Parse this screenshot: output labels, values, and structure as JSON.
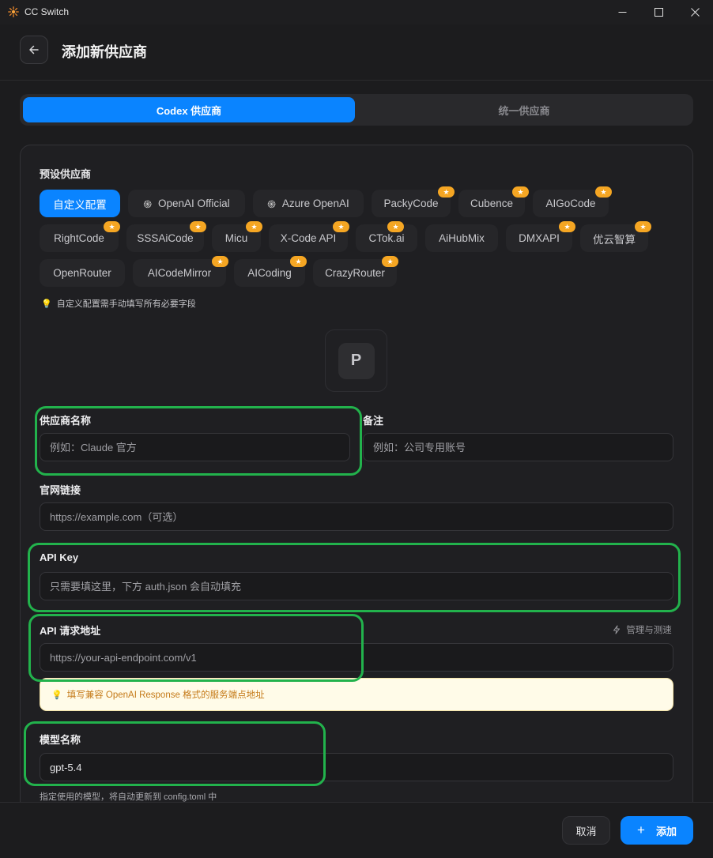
{
  "window": {
    "title": "CC Switch",
    "minimize": "—",
    "maximize": "☐",
    "close": "✕"
  },
  "header": {
    "title": "添加新供应商"
  },
  "tabs": [
    {
      "label": "Codex 供应商",
      "active": true
    },
    {
      "label": "统一供应商",
      "active": false
    }
  ],
  "presets": {
    "label": "预设供应商",
    "items": [
      {
        "label": "自定义配置",
        "active": true,
        "starred": false,
        "icon": ""
      },
      {
        "label": "OpenAI Official",
        "active": false,
        "starred": false,
        "icon": "openai-icon"
      },
      {
        "label": "Azure OpenAI",
        "active": false,
        "starred": false,
        "icon": "openai-icon"
      },
      {
        "label": "PackyCode",
        "active": false,
        "starred": true,
        "icon": ""
      },
      {
        "label": "Cubence",
        "active": false,
        "starred": true,
        "icon": ""
      },
      {
        "label": "AIGoCode",
        "active": false,
        "starred": true,
        "icon": ""
      },
      {
        "label": "RightCode",
        "active": false,
        "starred": true,
        "icon": ""
      },
      {
        "label": "SSSAiCode",
        "active": false,
        "starred": true,
        "icon": ""
      },
      {
        "label": "Micu",
        "active": false,
        "starred": true,
        "icon": ""
      },
      {
        "label": "X-Code API",
        "active": false,
        "starred": true,
        "icon": ""
      },
      {
        "label": "CTok.ai",
        "active": false,
        "starred": true,
        "icon": ""
      },
      {
        "label": "AiHubMix",
        "active": false,
        "starred": false,
        "icon": ""
      },
      {
        "label": "DMXAPI",
        "active": false,
        "starred": true,
        "icon": ""
      },
      {
        "label": "优云智算",
        "active": false,
        "starred": true,
        "icon": ""
      },
      {
        "label": "OpenRouter",
        "active": false,
        "starred": false,
        "icon": ""
      },
      {
        "label": "AICodeMirror",
        "active": false,
        "starred": true,
        "icon": ""
      },
      {
        "label": "AICoding",
        "active": false,
        "starred": true,
        "icon": ""
      },
      {
        "label": "CrazyRouter",
        "active": false,
        "starred": true,
        "icon": ""
      }
    ],
    "hint": "自定义配置需手动填写所有必要字段"
  },
  "avatar": {
    "letter": "P"
  },
  "form": {
    "name": {
      "label": "供应商名称",
      "placeholder": "例如：Claude 官方",
      "value": ""
    },
    "note": {
      "label": "备注",
      "placeholder": "例如：公司专用账号",
      "value": ""
    },
    "website": {
      "label": "官网链接",
      "placeholder": "https://example.com（可选）",
      "value": ""
    },
    "api_key": {
      "label": "API Key",
      "placeholder": "只需要填这里，下方 auth.json 会自动填充",
      "value": ""
    },
    "endpoint": {
      "label": "API 请求地址",
      "placeholder": "https://your-api-endpoint.com/v1",
      "value": "",
      "manage_label": "管理与测速",
      "warning": "填写兼容 OpenAI Response 格式的服务端点地址"
    },
    "model": {
      "label": "模型名称",
      "value": "gpt-5.4",
      "helper": "指定使用的模型，将自动更新到 config.toml 中"
    }
  },
  "footer": {
    "cancel_label": "取消",
    "add_label": "添加"
  },
  "colors": {
    "accent": "#0a84ff",
    "highlight": "#22b24c",
    "star": "#f5a623",
    "warning_bg": "#fffbe8",
    "warning_text": "#c57a18"
  }
}
